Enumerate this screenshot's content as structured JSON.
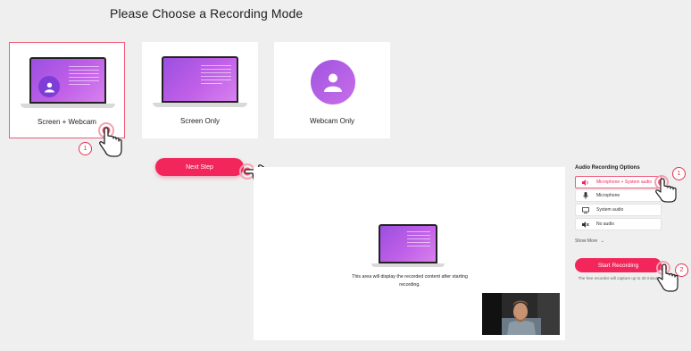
{
  "page": {
    "title": "Please Choose a Recording Mode"
  },
  "modes": [
    {
      "label": "Screen + Webcam",
      "selected": true
    },
    {
      "label": "Screen Only",
      "selected": false
    },
    {
      "label": "Webcam Only",
      "selected": false
    }
  ],
  "next_button": {
    "label": "Next Step"
  },
  "preview": {
    "message": "This area will display the recorded content after starting recording."
  },
  "audio": {
    "title": "Audio Recording Options",
    "options": [
      {
        "label": "Microphone + System audio",
        "icon": "speaker-icon",
        "active": true
      },
      {
        "label": "Microphone",
        "icon": "microphone-icon",
        "active": false
      },
      {
        "label": "System audio",
        "icon": "monitor-icon",
        "active": false
      },
      {
        "label": "No audio",
        "icon": "muted-speaker-icon",
        "active": false
      }
    ],
    "show_more": "Show More",
    "show_more_icon": "chevron-down-icon"
  },
  "start_button": {
    "label": "Start Recording"
  },
  "free_note": "The free recorder will capture up to 30 minutes at a time.",
  "steps": {
    "step1_top": "1",
    "step1_right": "1",
    "step2_right": "2"
  },
  "colors": {
    "accent": "#f2265a",
    "selected_border": "#f05a78",
    "purple": "#9b4fe0"
  }
}
